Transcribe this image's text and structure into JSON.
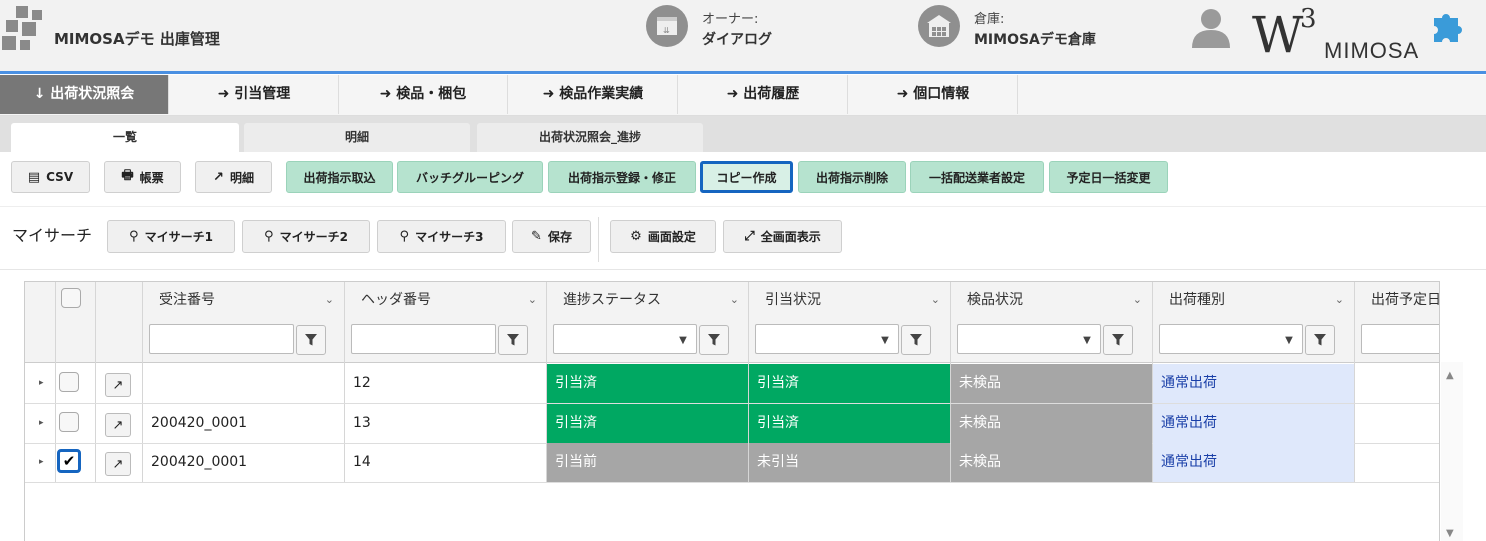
{
  "app": {
    "title": "MIMOSAデモ 出庫管理",
    "brand_main": "W",
    "brand_sup": "3",
    "brand_sub": "MIMOSA"
  },
  "owner": {
    "label": "オーナー:",
    "value": "ダイアログ"
  },
  "warehouse": {
    "label": "倉庫:",
    "value": "MIMOSAデモ倉庫"
  },
  "nav": [
    {
      "label": "出荷状況照会",
      "arrow": "↓",
      "active": true
    },
    {
      "label": "引当管理",
      "arrow": "➜"
    },
    {
      "label": "検品・梱包",
      "arrow": "➜"
    },
    {
      "label": "検品作業実績",
      "arrow": "➜"
    },
    {
      "label": "出荷履歴",
      "arrow": "➜"
    },
    {
      "label": "個口情報",
      "arrow": "➜"
    }
  ],
  "subtabs": [
    {
      "label": "一覧",
      "active": true
    },
    {
      "label": "明細"
    },
    {
      "label": "出荷状況照会_進捗"
    }
  ],
  "toolbar": {
    "csv": "CSV",
    "report": "帳票",
    "detail": "明細",
    "import": "出荷指示取込",
    "batch": "バッチグルーピング",
    "register": "出荷指示登録・修正",
    "copy": "コピー作成",
    "delete": "出荷指示削除",
    "carrier": "一括配送業者設定",
    "date": "予定日一括変更"
  },
  "search": {
    "label": "マイサーチ",
    "my1": "マイサーチ1",
    "my2": "マイサーチ2",
    "my3": "マイサーチ3",
    "save": "保存",
    "screen_settings": "画面設定",
    "fullscreen": "全画面表示"
  },
  "grid": {
    "columns": [
      "受注番号",
      "ヘッダ番号",
      "進捗ステータス",
      "引当状況",
      "検品状況",
      "出荷種別",
      "出荷予定日"
    ],
    "rows": [
      {
        "checked": false,
        "order_no": "",
        "header_no": "12",
        "progress": "引当済",
        "alloc": "引当済",
        "inspect": "未検品",
        "ship_type": "通常出荷"
      },
      {
        "checked": false,
        "order_no": "200420_0001",
        "header_no": "13",
        "progress": "引当済",
        "alloc": "引当済",
        "inspect": "未検品",
        "ship_type": "通常出荷"
      },
      {
        "checked": true,
        "order_no": "200420_0001",
        "header_no": "14",
        "progress": "引当前",
        "alloc": "未引当",
        "inspect": "未検品",
        "ship_type": "通常出荷"
      }
    ]
  },
  "colors": {
    "accent": "#4a90e2",
    "status_green": "#00a862",
    "status_gray": "#a6a6a6",
    "ship_bg": "#dfe8fb",
    "ship_text": "#1a3fa8",
    "button_green": "#b6e3cf"
  }
}
